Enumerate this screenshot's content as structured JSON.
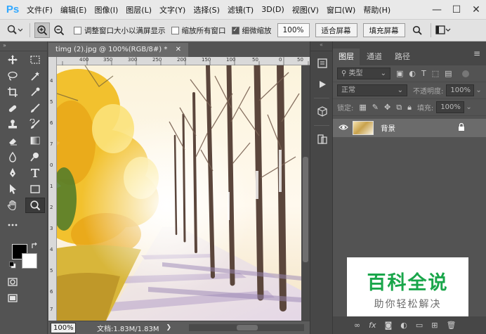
{
  "app": {
    "logo": "Ps"
  },
  "menu": [
    "文件(F)",
    "编辑(E)",
    "图像(I)",
    "图层(L)",
    "文字(Y)",
    "选择(S)",
    "滤镜(T)",
    "3D(D)",
    "视图(V)",
    "窗口(W)",
    "帮助(H)"
  ],
  "window_controls": {
    "minimize": "—",
    "maximize": "☐",
    "close": "✕"
  },
  "options": {
    "resize_windows": "调整窗口大小以满屏显示",
    "zoom_all": "缩放所有窗口",
    "scrubby_zoom": "细微缩放",
    "zoom_value": "100%",
    "fit_screen": "适合屏幕",
    "fill_screen": "填充屏幕"
  },
  "document": {
    "tab_title": "timg (2).jpg @ 100%(RGB/8#) *",
    "zoom": "100%",
    "doc_size": "文档:1.83M/1.83M",
    "ruler_h": [
      "400",
      "350",
      "300",
      "250",
      "200",
      "150",
      "100",
      "50",
      "0",
      "50"
    ],
    "ruler_v": [
      "4",
      "5",
      "6",
      "7",
      "0",
      "1",
      "2",
      "3",
      "4",
      "5",
      "6",
      "7"
    ]
  },
  "layers_panel": {
    "tabs": [
      "图层",
      "通道",
      "路径"
    ],
    "filter_kind": "类型",
    "blend_mode": "正常",
    "opacity_label": "不透明度:",
    "opacity_value": "100%",
    "lock_label": "锁定:",
    "fill_label": "填充:",
    "fill_value": "100%",
    "layer_name": "背景"
  },
  "watermark": {
    "main": "百科全说",
    "sub": "助你轻松解决"
  }
}
